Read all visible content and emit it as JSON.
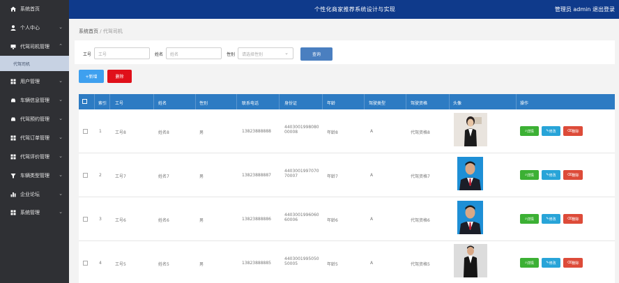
{
  "topbar": {
    "title": "个性化商家推荐系统设计与实现",
    "user_label": "管理员 admin  退出登录"
  },
  "sidebar": {
    "items": [
      {
        "label": "系统首页",
        "icon": "home-icon",
        "chevron": ""
      },
      {
        "label": "个人中心",
        "icon": "user-icon",
        "chevron": "⌄"
      },
      {
        "label": "代驾司机管理",
        "icon": "monitor-icon",
        "chevron": "⌃"
      },
      {
        "label": "用户管理",
        "icon": "grid-icon",
        "chevron": "⌄"
      },
      {
        "label": "车辆信息管理",
        "icon": "car-icon",
        "chevron": "⌄"
      },
      {
        "label": "代驾预约管理",
        "icon": "car-icon",
        "chevron": "⌄"
      },
      {
        "label": "代驾订单管理",
        "icon": "grid-icon",
        "chevron": "⌄"
      },
      {
        "label": "代驾评价管理",
        "icon": "grid-icon",
        "chevron": "⌄"
      },
      {
        "label": "车辆类型管理",
        "icon": "filter-icon",
        "chevron": "⌄"
      },
      {
        "label": "企业论坛",
        "icon": "bar-chart-icon",
        "chevron": "⌄"
      },
      {
        "label": "系统管理",
        "icon": "grid-icon",
        "chevron": "⌄"
      }
    ],
    "subitem": "代驾司机"
  },
  "breadcrumb": {
    "home": "系统首页",
    "sep": "/",
    "current": "代驾司机"
  },
  "search": {
    "field1_label": "工号",
    "field1_placeholder": "工号",
    "field2_label": "姓名",
    "field2_placeholder": "姓名",
    "field3_label": "性别",
    "field3_placeholder": "请选择性别",
    "query_button": "查询"
  },
  "toolbar": {
    "add_label": "+新增",
    "delete_label": "删除"
  },
  "table": {
    "headers": [
      "索引",
      "工号",
      "姓名",
      "性别",
      "联系电话",
      "身份证",
      "年龄",
      "驾驶类型",
      "驾驶资格",
      "头像",
      "操作"
    ],
    "rows": [
      {
        "index": "1",
        "job_no": "工号8",
        "name": "姓名8",
        "gender": "男",
        "phone": "13823888888",
        "id_line1": "4403001998080",
        "id_line2": "00008",
        "age": "年龄8",
        "type": "A",
        "qual": "代驾资格8"
      },
      {
        "index": "2",
        "job_no": "工号7",
        "name": "姓名7",
        "gender": "男",
        "phone": "13823888887",
        "id_line1": "4403001997070",
        "id_line2": "70007",
        "age": "年龄7",
        "type": "A",
        "qual": "代驾资格7"
      },
      {
        "index": "3",
        "job_no": "工号6",
        "name": "姓名6",
        "gender": "男",
        "phone": "13823888886",
        "id_line1": "4403001996060",
        "id_line2": "60006",
        "age": "年龄6",
        "type": "A",
        "qual": "代驾资格6"
      },
      {
        "index": "4",
        "job_no": "工号5",
        "name": "姓名5",
        "gender": "男",
        "phone": "13823888885",
        "id_line1": "4403001995050",
        "id_line2": "50005",
        "age": "年龄5",
        "type": "A",
        "qual": "代驾资格5"
      }
    ],
    "actions": {
      "view": "详情",
      "edit": "修改",
      "delete": "删除"
    }
  },
  "colors": {
    "topbar": "#0f3a8b",
    "sidebar": "#2f3034",
    "table_header": "#2d7bc3",
    "add": "#3ea0ef",
    "delete": "#e0101a"
  }
}
